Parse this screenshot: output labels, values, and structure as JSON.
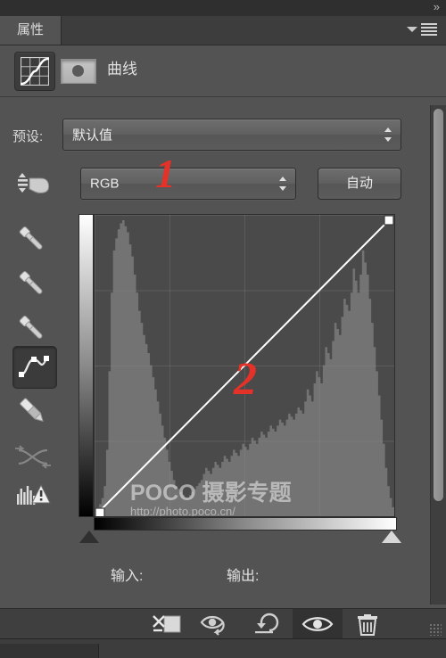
{
  "window": {
    "collapse_chevrons": "»"
  },
  "panel": {
    "tab_label": "属性",
    "menu_icon": "panel-menu-icon",
    "adjustment_icon": "curves-adjustment-icon",
    "mask_thumbnail_icon": "layer-mask-thumbnail",
    "title": "曲线"
  },
  "preset": {
    "label": "预设:",
    "value": "默认值"
  },
  "channel": {
    "value": "RGB",
    "auto_button": "自动",
    "scrub_tool_icon": "on-image-adjust-icon"
  },
  "tools": [
    {
      "name": "black-point-eyedropper",
      "icon": "eyedropper-icon",
      "selected": false
    },
    {
      "name": "gray-point-eyedropper",
      "icon": "eyedropper-icon",
      "selected": false
    },
    {
      "name": "white-point-eyedropper",
      "icon": "eyedropper-icon",
      "selected": false
    },
    {
      "name": "curve-point-tool",
      "icon": "curve-point-icon",
      "selected": true
    },
    {
      "name": "pencil-tool",
      "icon": "pencil-icon",
      "selected": false
    },
    {
      "name": "smooth-curve-tool",
      "icon": "smooth-curve-icon",
      "selected": false
    },
    {
      "name": "clipping-warning",
      "icon": "clipping-warning-icon",
      "selected": false
    }
  ],
  "io": {
    "input_label": "输入:",
    "input_value": "",
    "output_label": "输出:",
    "output_value": ""
  },
  "watermark": {
    "main": "POCO 摄影专题",
    "url": "http://photo.poco.cn/"
  },
  "annotations": [
    {
      "label": "1",
      "target": "channel-select"
    },
    {
      "label": "2",
      "target": "curve-line"
    }
  ],
  "bottom_toolbar": [
    {
      "name": "clip-to-layer-button",
      "icon": "clip-to-layer-icon",
      "active": false
    },
    {
      "name": "preview-eye-button",
      "icon": "eye-arrow-icon",
      "active": false
    },
    {
      "name": "reset-button",
      "icon": "undo-arrow-icon",
      "active": false
    },
    {
      "name": "toggle-visibility-button",
      "icon": "eye-icon",
      "active": true
    },
    {
      "name": "delete-button",
      "icon": "trash-icon",
      "active": false
    }
  ],
  "next_panel_tab": "",
  "colors": {
    "panel_bg": "#535353",
    "tab_bg": "#3d3d3d",
    "plot_bg": "#4a4a4a",
    "curve_line": "#ffffff",
    "histogram": "#8d8d8d",
    "annotation_red": "#e43228",
    "text": "#e0e0e0"
  },
  "chart_data": {
    "type": "line",
    "title": "RGB Curves",
    "xlabel": "输入 (Input)",
    "ylabel": "输出 (Output)",
    "xlim": [
      0,
      255
    ],
    "ylim": [
      0,
      255
    ],
    "grid": true,
    "grid_divisions": 4,
    "legend": "none",
    "curve_points": [
      {
        "input": 0,
        "output": 0
      },
      {
        "input": 255,
        "output": 255
      }
    ],
    "curve_is_linear": true,
    "histogram_bins": [
      2,
      3,
      4,
      6,
      10,
      22,
      48,
      74,
      88,
      92,
      95,
      97,
      98,
      96,
      94,
      90,
      86,
      80,
      74,
      68,
      64,
      60,
      57,
      54,
      50,
      46,
      42,
      38,
      34,
      30,
      26,
      22,
      18,
      15,
      12,
      10,
      9,
      8,
      7,
      6,
      6,
      7,
      8,
      9,
      10,
      11,
      12,
      14,
      16,
      15,
      14,
      16,
      18,
      17,
      16,
      18,
      20,
      19,
      18,
      20,
      22,
      21,
      20,
      22,
      24,
      23,
      22,
      24,
      26,
      25,
      24,
      26,
      28,
      27,
      26,
      28,
      30,
      29,
      28,
      30,
      32,
      31,
      30,
      32,
      34,
      33,
      32,
      34,
      36,
      35,
      34,
      38,
      42,
      40,
      38,
      44,
      48,
      46,
      44,
      50,
      56,
      54,
      52,
      58,
      64,
      62,
      60,
      66,
      72,
      70,
      68,
      74,
      82,
      78,
      74,
      80,
      88,
      84,
      80,
      72,
      64,
      56,
      48,
      40,
      32,
      24,
      16,
      10,
      6,
      3
    ],
    "histogram_channel": "RGB composite"
  }
}
